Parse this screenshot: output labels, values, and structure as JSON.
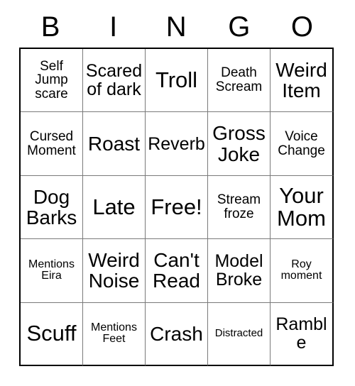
{
  "card": {
    "header_letters": [
      "B",
      "I",
      "N",
      "G",
      "O"
    ],
    "rows": [
      [
        {
          "text": "Self Jump scare",
          "size": "fs-sm"
        },
        {
          "text": "Scared of dark",
          "size": "fs-md"
        },
        {
          "text": "Troll",
          "size": "fs-xl"
        },
        {
          "text": "Death Scream",
          "size": "fs-sm"
        },
        {
          "text": "Weird Item",
          "size": "fs-lg"
        }
      ],
      [
        {
          "text": "Cursed Moment",
          "size": "fs-sm"
        },
        {
          "text": "Roast",
          "size": "fs-lg"
        },
        {
          "text": "Reverb",
          "size": "fs-md"
        },
        {
          "text": "Gross Joke",
          "size": "fs-lg"
        },
        {
          "text": "Voice Change",
          "size": "fs-sm"
        }
      ],
      [
        {
          "text": "Dog Barks",
          "size": "fs-lg"
        },
        {
          "text": "Late",
          "size": "fs-xl"
        },
        {
          "text": "Free!",
          "size": "fs-xl"
        },
        {
          "text": "Stream froze",
          "size": "fs-sm"
        },
        {
          "text": "Your Mom",
          "size": "fs-xl"
        }
      ],
      [
        {
          "text": "Mentions Eira",
          "size": "fs-xs"
        },
        {
          "text": "Weird Noise",
          "size": "fs-lg"
        },
        {
          "text": "Can't Read",
          "size": "fs-lg"
        },
        {
          "text": "Model Broke",
          "size": "fs-md"
        },
        {
          "text": "Roy moment",
          "size": "fs-xs"
        }
      ],
      [
        {
          "text": "Scuff",
          "size": "fs-xl"
        },
        {
          "text": "Mentions Feet",
          "size": "fs-xs"
        },
        {
          "text": "Crash",
          "size": "fs-lg"
        },
        {
          "text": "Distracted",
          "size": "fs-xxs"
        },
        {
          "text": "Ramble",
          "size": "fs-md"
        }
      ]
    ]
  },
  "style": {
    "outer_border_color": "#000000",
    "inner_grid_color": "#7a7a7a",
    "text_color": "#000000",
    "background_color": "#ffffff"
  }
}
